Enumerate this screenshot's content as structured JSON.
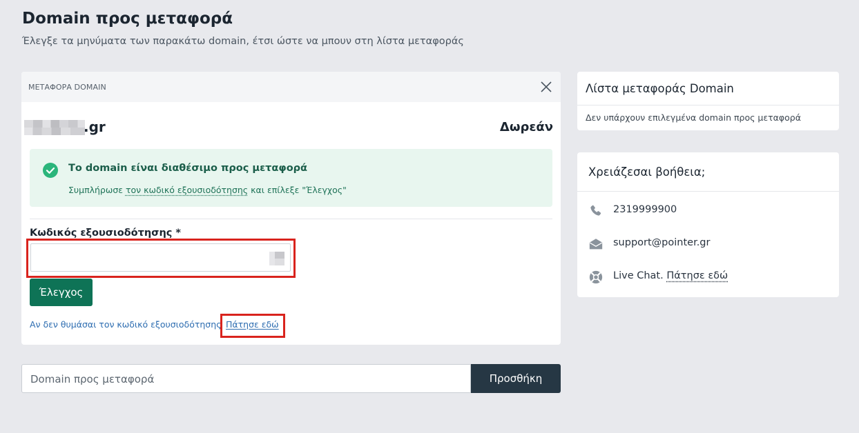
{
  "page": {
    "title": "Domain προς μεταφορά",
    "subtitle": "Έλεγξε τα μηνύματα των παρακάτω domain, έτσι ώστε να μπουν στη λίστα μεταφοράς"
  },
  "transfer_card": {
    "header_label": "ΜΕΤΑΦΟΡΑ DOMAIN",
    "close_icon": "close-icon",
    "domain_tld": ".gr",
    "price": "Δωρεάν",
    "status": {
      "icon": "check-circle-icon",
      "title": "Το domain είναι διαθέσιμο προς μεταφορά",
      "text_before": "Συμπλήρωσε ",
      "text_link": "τον κωδικό εξουσιοδότησης",
      "text_after": " και επίλεξε \"Έλεγχος\""
    },
    "auth_field": {
      "label": "Κωδικός εξουσιοδότησης *",
      "value": ""
    },
    "check_button": "Έλεγχος",
    "forgot_text": "Αν δεν θυμάσαι τον κωδικό εξουσιοδότησης",
    "forgot_link": "Πάτησε εδώ"
  },
  "add_domain": {
    "placeholder": "Domain προς μεταφορά",
    "button": "Προσθήκη"
  },
  "transfer_list": {
    "title": "Λίστα μεταφοράς Domain",
    "empty_text": "Δεν υπάρχουν επιλεγμένα domain προς μεταφορά"
  },
  "help": {
    "title": "Χρειάζεσαι βοήθεια;",
    "items": [
      {
        "icon": "phone-icon",
        "text": "2319999900"
      },
      {
        "icon": "envelope-icon",
        "text": "support@pointer.gr"
      },
      {
        "icon": "lifebuoy-icon",
        "text": "Live Chat. ",
        "link": "Πάτησε εδώ"
      }
    ]
  },
  "colors": {
    "background": "#e8e9ed",
    "primary_green": "#0e7356",
    "success_bg": "#e8f6ef",
    "dark_button": "#263744",
    "link_blue": "#2c6cb0",
    "highlight_red": "#d9231d"
  }
}
